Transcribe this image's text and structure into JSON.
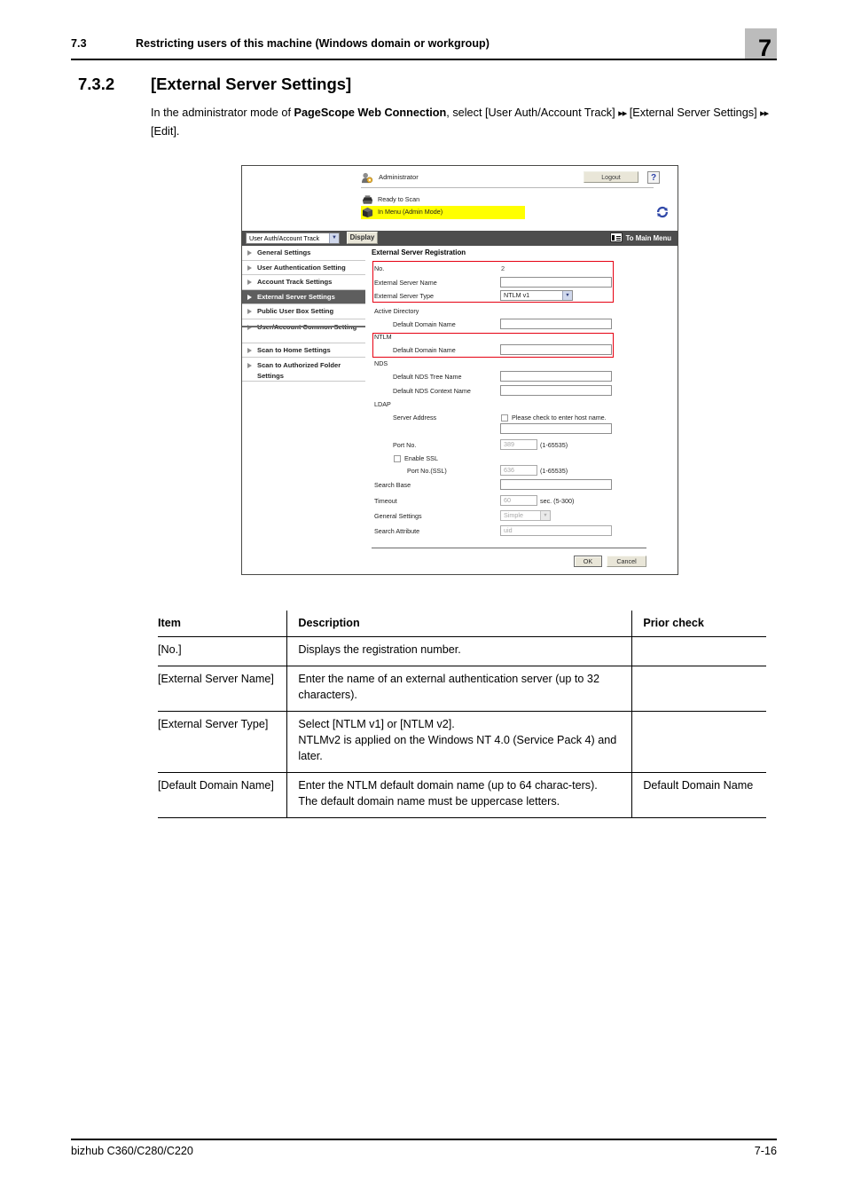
{
  "header": {
    "section_number": "7.3",
    "section_title": "Restricting users of this machine (Windows domain or workgroup)",
    "chapter_number": "7"
  },
  "section": {
    "number": "7.3.2",
    "title": "[External Server Settings]",
    "intro_prefix": "In the administrator mode of ",
    "intro_bold": "PageScope Web Connection",
    "intro_mid": ", select [User Auth/Account Track] ",
    "intro_arrow1": "▸▸",
    "intro_after1": " [External Server Settings] ",
    "intro_arrow2": "▸▸",
    "intro_after2": " [Edit]."
  },
  "screenshot": {
    "topbar": {
      "user_label": "Administrator",
      "logout_label": "Logout",
      "help_label": "?",
      "status_ready": "Ready to Scan",
      "status_menu": "In Menu (Admin Mode)",
      "refresh_icon": "refresh-icon",
      "admin_icon": "user-admin-icon",
      "printer_icon": "printer-icon"
    },
    "toolbar": {
      "select_value": "User Auth/Account Track",
      "display_label": "Display",
      "main_menu_label": "To Main Menu",
      "main_menu_icon": "menu-list-icon"
    },
    "nav": {
      "items": [
        {
          "label": "General Settings",
          "active": false,
          "two_line": false
        },
        {
          "label": "User Authentication Setting",
          "active": false,
          "two_line": false
        },
        {
          "label": "Account Track Settings",
          "active": false,
          "two_line": false
        },
        {
          "label": "External Server Settings",
          "active": true,
          "two_line": false
        },
        {
          "label": "Public User Box Setting",
          "active": false,
          "two_line": false
        },
        {
          "label": "User/Account Common Setting",
          "active": false,
          "two_line": true
        },
        {
          "label": "Scan to Home Settings",
          "active": false,
          "two_line": false
        },
        {
          "label": "Scan to Authorized Folder Settings",
          "active": false,
          "two_line": true
        }
      ]
    },
    "form": {
      "title": "External Server Registration",
      "no_label": "No.",
      "no_value": "2",
      "server_name_label": "External Server Name",
      "server_name_value": "",
      "server_type_label": "External Server Type",
      "server_type_value": "NTLM v1",
      "group_active_directory": "Active Directory",
      "ad_default_domain_label": "Default Domain Name",
      "ad_default_domain_value": "",
      "group_ntlm": "NTLM",
      "ntlm_default_domain_label": "Default Domain Name",
      "ntlm_default_domain_value": "",
      "group_nds": "NDS",
      "nds_tree_label": "Default NDS Tree Name",
      "nds_tree_value": "",
      "nds_context_label": "Default NDS Context Name",
      "nds_context_value": "",
      "group_ldap": "LDAP",
      "server_address_label": "Server Address",
      "host_name_check_label": "Please check to enter host name.",
      "server_address_value": "",
      "port_no_label": "Port No.",
      "port_no_value": "389",
      "port_no_range": "(1-65535)",
      "enable_ssl_label": "Enable SSL",
      "port_ssl_label": "Port No.(SSL)",
      "port_ssl_value": "636",
      "port_ssl_range": "(1-65535)",
      "search_base_label": "Search Base",
      "search_base_value": "",
      "timeout_label": "Timeout",
      "timeout_value": "60",
      "timeout_suffix": "sec. (5-300)",
      "general_settings_label": "General Settings",
      "general_settings_value": "Simple",
      "search_attribute_label": "Search Attribute",
      "search_attribute_value": "uid",
      "ok_label": "OK",
      "cancel_label": "Cancel"
    }
  },
  "table": {
    "headers": [
      "Item",
      "Description",
      "Prior check"
    ],
    "rows": [
      {
        "item": "[No.]",
        "description": "Displays the registration number.",
        "prior": ""
      },
      {
        "item": "[External Server Name]",
        "description": "Enter the name of an external authentication server (up to 32 characters).",
        "prior": ""
      },
      {
        "item": "[External Server Type]",
        "description": "Select [NTLM v1] or [NTLM v2].\nNTLMv2 is applied on the Windows NT 4.0 (Service Pack 4) and later.",
        "prior": ""
      },
      {
        "item": "[Default Domain Name]",
        "description": "Enter the NTLM default domain name (up to 64 charac-ters).\nThe default domain name must be uppercase letters.",
        "prior": "Default Domain Name"
      }
    ]
  },
  "footer": {
    "model": "bizhub C360/C280/C220",
    "page": "7-16"
  }
}
